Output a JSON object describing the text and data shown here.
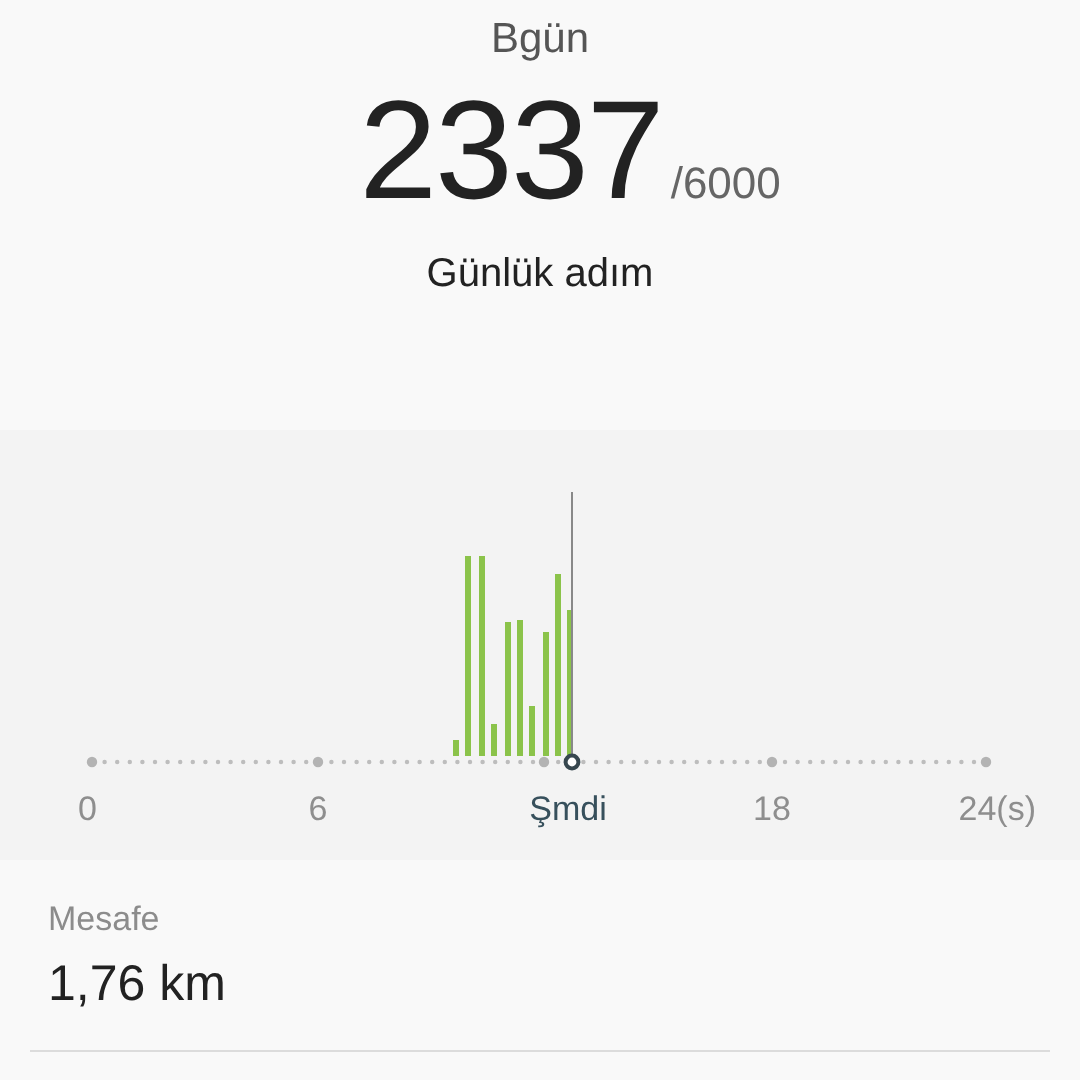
{
  "header": {
    "title": "Bgün",
    "steps": "2337",
    "goal": "/6000",
    "caption": "Günlük adım"
  },
  "timeline": {
    "axis_labels": [
      {
        "label": "0",
        "kind": "tick"
      },
      {
        "label": "6",
        "kind": "tick"
      },
      {
        "label": "Şmdi",
        "kind": "now"
      },
      {
        "label": "18",
        "kind": "tick"
      },
      {
        "label": "24(s)",
        "kind": "tick"
      }
    ]
  },
  "distance": {
    "label": "Mesafe",
    "value": "1,76 km"
  }
}
